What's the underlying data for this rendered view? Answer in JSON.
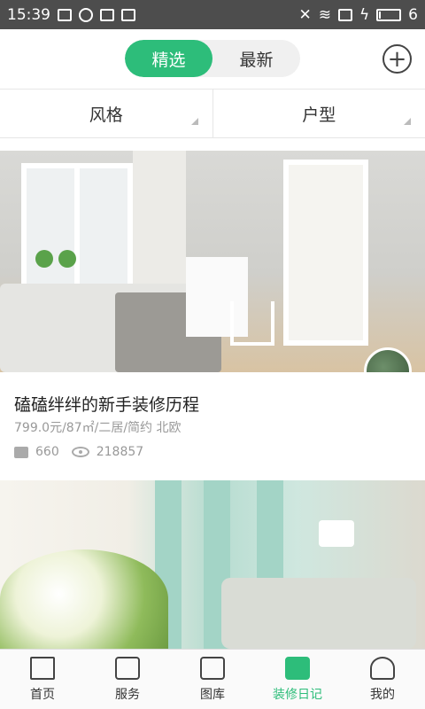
{
  "status_bar": {
    "time": "15:39",
    "battery_level": "6",
    "battery_fill": 0.06
  },
  "header": {
    "tabs": [
      {
        "label": "精选",
        "active": true
      },
      {
        "label": "最新",
        "active": false
      }
    ],
    "add_icon": "plus-circle-icon"
  },
  "filters": [
    {
      "label": "风格"
    },
    {
      "label": "户型"
    }
  ],
  "cards": [
    {
      "title": "磕磕绊绊的新手装修历程",
      "subtitle": "799.0元/87㎡/二居/简约 北欧",
      "comments": "660",
      "views": "218857"
    }
  ],
  "tabbar": {
    "items": [
      {
        "label": "首页",
        "icon": "home-icon",
        "active": false
      },
      {
        "label": "服务",
        "icon": "toolbox-icon",
        "active": false
      },
      {
        "label": "图库",
        "icon": "gallery-icon",
        "active": false
      },
      {
        "label": "装修日记",
        "icon": "diary-icon",
        "active": true
      },
      {
        "label": "我的",
        "icon": "person-icon",
        "active": false
      }
    ]
  },
  "colors": {
    "accent": "#2dbd7a",
    "status_bar": "#4d4d4d"
  }
}
